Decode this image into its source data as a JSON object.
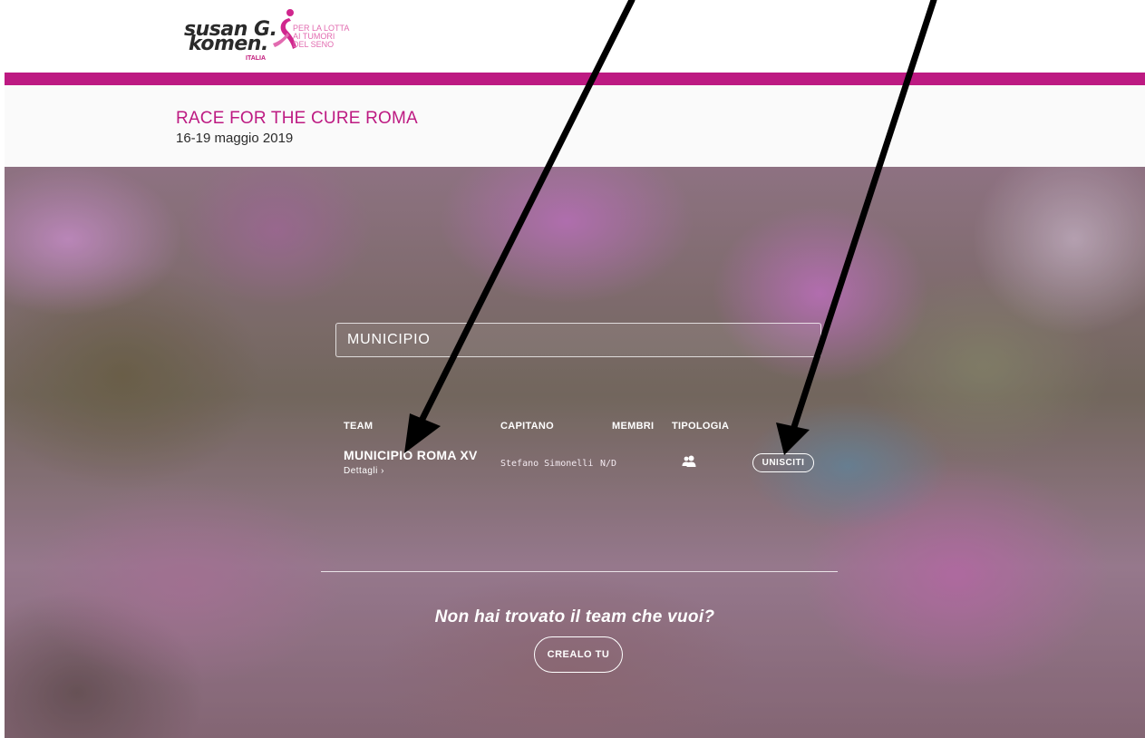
{
  "logo": {
    "line1": "susan G.",
    "line2": "komen.",
    "country": "ITALIA",
    "tagline": [
      "PER LA LOTTA",
      "AI TUMORI",
      "DEL SENO"
    ]
  },
  "event": {
    "title": "RACE FOR THE CURE ROMA",
    "dates": "16-19 maggio 2019"
  },
  "search": {
    "value": "MUNICIPIO"
  },
  "results": {
    "headers": {
      "team": "TEAM",
      "captain": "CAPITANO",
      "members": "MEMBRI",
      "type": "TIPOLOGIA"
    },
    "rows": [
      {
        "team": "MUNICIPIO ROMA XV",
        "details": "Dettagli ›",
        "captain": "Stefano Simonelli",
        "members": "N/D",
        "type_icon": "group-icon",
        "action": "UNISCITI"
      }
    ]
  },
  "footer": {
    "prompt": "Non hai trovato il team che vuoi?",
    "create_label": "CREALO TU"
  },
  "colors": {
    "brand_magenta": "#bd1a82",
    "text_dark": "#2b2b2b",
    "annotation_arrow": "#000000"
  }
}
